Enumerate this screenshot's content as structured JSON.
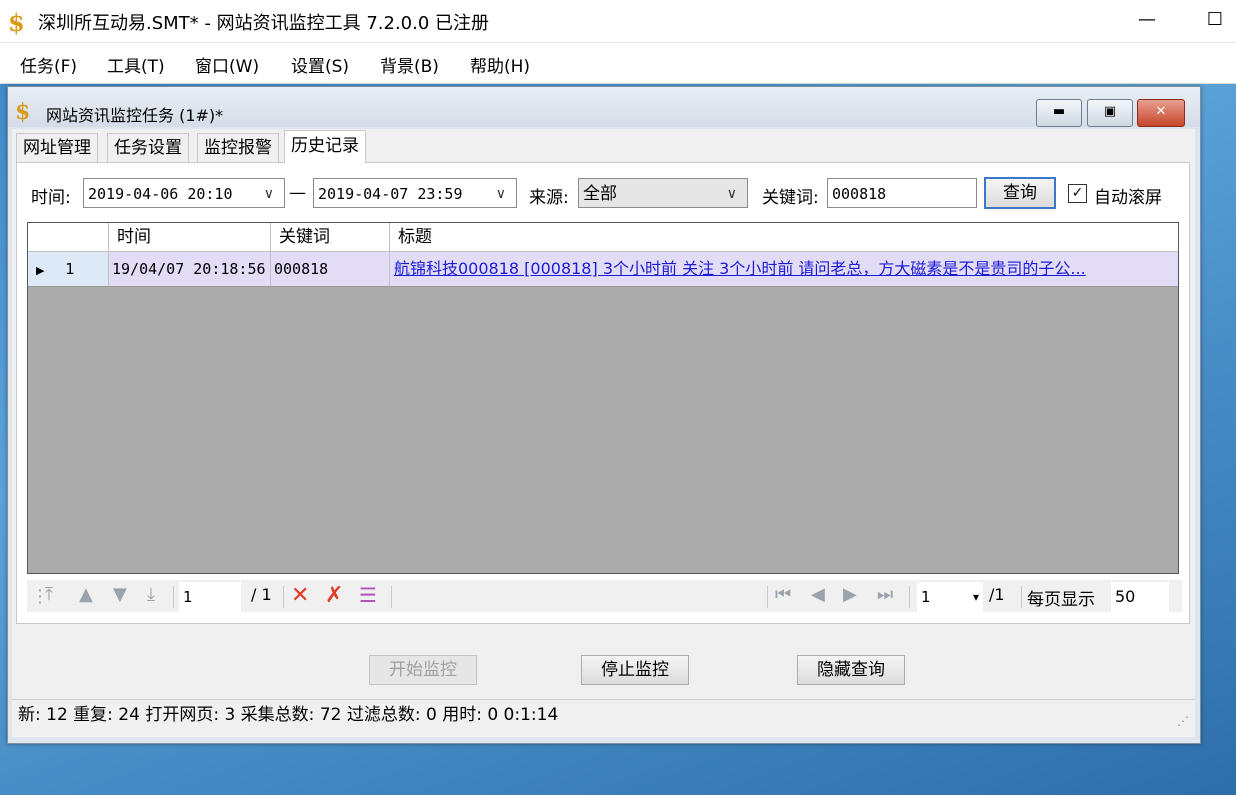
{
  "app": {
    "title": "深圳所互动易.SMT* - 网站资讯监控工具 7.2.0.0 已注册",
    "icon": "dollar-s-icon"
  },
  "window_controls": {
    "minimize": "—",
    "maximize": "☐"
  },
  "menu": [
    {
      "label": "任务(F)"
    },
    {
      "label": "工具(T)"
    },
    {
      "label": "窗口(W)"
    },
    {
      "label": "设置(S)"
    },
    {
      "label": "背景(B)"
    },
    {
      "label": "帮助(H)"
    }
  ],
  "child_window": {
    "title": "网站资讯监控任务 (1#)*",
    "tabs": [
      {
        "label": "网址管理"
      },
      {
        "label": "任务设置"
      },
      {
        "label": "监控报警"
      },
      {
        "label": "历史记录"
      }
    ]
  },
  "filter": {
    "time_label": "时间:",
    "start": "2019-04-06 20:10",
    "dash": "—",
    "end": "2019-04-07 23:59",
    "source_label": "来源:",
    "source_value": "全部",
    "keyword_label": "关键词:",
    "keyword_value": "000818",
    "query_button": "查询",
    "autoscroll_label": "自动滚屏",
    "autoscroll_checked": "✓"
  },
  "grid": {
    "columns": [
      "时间",
      "关键词",
      "标题"
    ],
    "rows": [
      {
        "indicator": "▶",
        "index": "1",
        "time": "19/04/07 20:18:56",
        "keyword": "000818",
        "title": "航锦科技000818 [000818] 3个小时前 关注 3个小时前 请问老总，方大磁素是不是贵司的子公..."
      }
    ]
  },
  "nav": {
    "page_input": "1",
    "page_total": "/ 1",
    "page_select": "1",
    "page_select_total": "/1",
    "per_page_label": "每页显示",
    "per_page_value": "50"
  },
  "buttons": {
    "start": "开始监控",
    "stop": "停止监控",
    "hide_query": "隐藏查询"
  },
  "status": {
    "text": "新: 12  重复: 24  打开网页: 3  采集总数: 72  过滤总数: 0  用时: 0 0:1:14"
  },
  "colors": {
    "accent": "#3a78c8",
    "row_selected": "#e3dcf7",
    "link": "#1b1bd6",
    "grid_bg": "#ababab"
  }
}
